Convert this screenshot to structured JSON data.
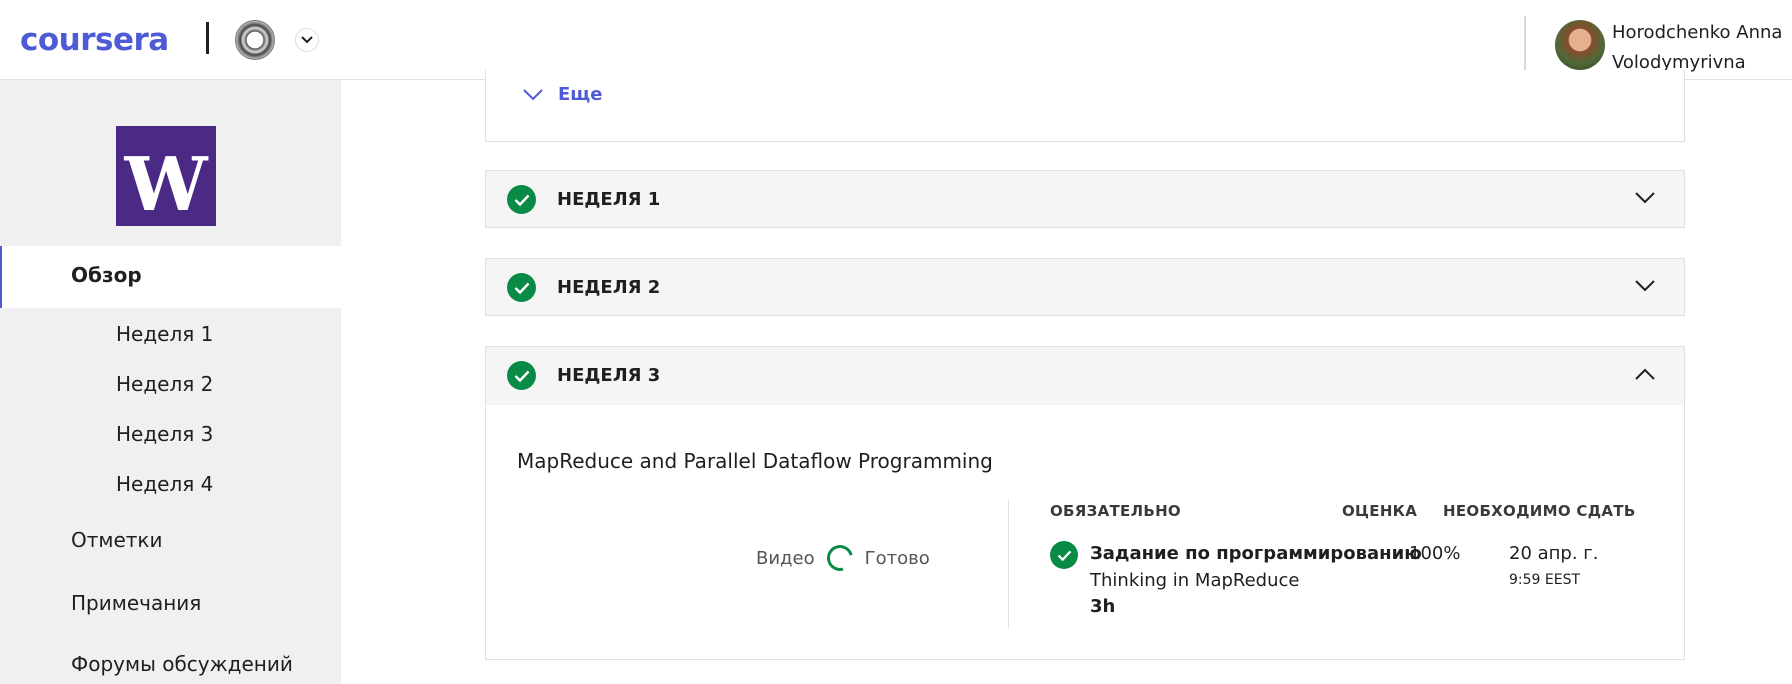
{
  "header": {
    "logo": "coursera",
    "user_name_line1": "Horodchenko Anna",
    "user_name_line2": "Volodymyrivna",
    "icons": [
      "university-seal-icon",
      "chevron-down-icon",
      "user-avatar"
    ]
  },
  "sidebar": {
    "logo_letter": "W",
    "active_item": "Обзор",
    "sub_items": [
      "Неделя 1",
      "Неделя 2",
      "Неделя 3",
      "Неделя 4"
    ],
    "items": [
      "Отметки",
      "Примечания",
      "Форумы обсуждений"
    ]
  },
  "main": {
    "more_label": "Еще",
    "weeks": [
      {
        "title": "НЕДЕЛЯ 1",
        "completed": true,
        "expanded": false
      },
      {
        "title": "НЕДЕЛЯ 2",
        "completed": true,
        "expanded": false
      },
      {
        "title": "НЕДЕЛЯ 3",
        "completed": true,
        "expanded": true
      }
    ],
    "module": {
      "title": "MapReduce and Parallel Dataflow Programming",
      "progress_label": "Видео",
      "progress_status": "Готово",
      "columns": {
        "required": "ОБЯЗАТЕЛЬНО",
        "grade": "ОЦЕНКА",
        "due": "НЕОБХОДИМО СДАТЬ"
      },
      "task": {
        "type": "Задание по программированию",
        "name": "Thinking in MapReduce",
        "duration": "3h",
        "score": "100%",
        "due_date": "20 апр. г.",
        "due_time": "9:59 EEST"
      }
    }
  },
  "colors": {
    "accent": "#4f5bd5",
    "success": "#0a8a47",
    "uw_purple": "#4b2a85"
  }
}
